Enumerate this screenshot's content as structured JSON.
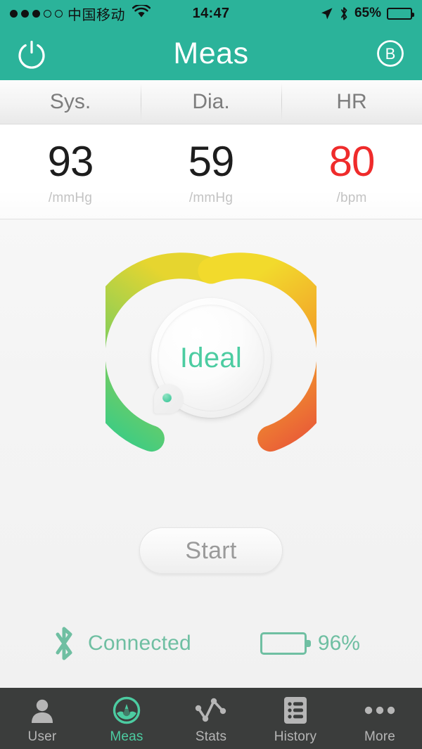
{
  "status_bar": {
    "signal_dots_filled": 3,
    "signal_dots_total": 5,
    "carrier": "中国移动",
    "wifi_icon": "wifi-icon",
    "time": "14:47",
    "location_icon": "location-arrow-icon",
    "bluetooth_icon": "bluetooth-icon",
    "battery_percent_label": "65%",
    "battery_level": 65
  },
  "nav_bar": {
    "title": "Meas",
    "left_button": {
      "name": "power-button",
      "icon": "power-icon"
    },
    "right_button": {
      "name": "bluetooth-pair-button",
      "label": "B",
      "icon": "circled-b-icon"
    },
    "background_color": "#2bb39a"
  },
  "readings": {
    "columns": [
      {
        "header": "Sys.",
        "value": "93",
        "unit": "/mmHg",
        "color": "#1d1d1d"
      },
      {
        "header": "Dia.",
        "value": "59",
        "unit": "/mmHg",
        "color": "#1d1d1d"
      },
      {
        "header": "HR",
        "value": "80",
        "unit": "/bpm",
        "color": "#ef2b2b"
      }
    ]
  },
  "gauge": {
    "label": "Ideal",
    "label_color": "#4ccca1",
    "pointer_position_label": "low-green-zone",
    "gradient_stops": [
      {
        "name": "green-end",
        "color": "#2ecb8d"
      },
      {
        "name": "light-green",
        "color": "#7ece5c"
      },
      {
        "name": "yellow-top",
        "color": "#f0d92e"
      },
      {
        "name": "orange",
        "color": "#f0a32a"
      },
      {
        "name": "red-end",
        "color": "#e8513a"
      }
    ],
    "arc_sweep_degrees": 280
  },
  "start_button": {
    "label": "Start"
  },
  "connection": {
    "bluetooth_icon": "bluetooth-icon",
    "status_text": "Connected",
    "device_battery_icon": "battery-icon",
    "device_battery_label": "96%",
    "device_battery_level": 96,
    "accent_color": "#6fbfa2"
  },
  "tab_bar": {
    "background_color": "#3b3d3c",
    "active_color": "#4ccca1",
    "inactive_color": "#b6b6b6",
    "items": [
      {
        "label": "User",
        "icon": "user-icon",
        "active": false
      },
      {
        "label": "Meas",
        "icon": "gauge-icon",
        "active": true
      },
      {
        "label": "Stats",
        "icon": "line-chart-icon",
        "active": false
      },
      {
        "label": "History",
        "icon": "list-document-icon",
        "active": false
      },
      {
        "label": "More",
        "icon": "ellipsis-icon",
        "active": false
      }
    ]
  }
}
